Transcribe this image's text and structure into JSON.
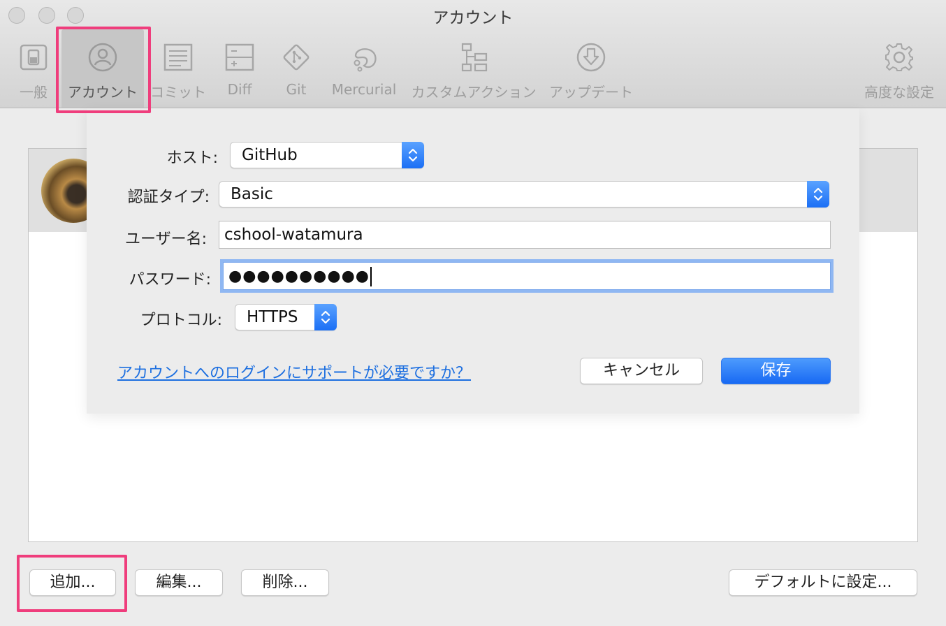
{
  "window": {
    "title": "アカウント"
  },
  "toolbar": {
    "items": [
      {
        "label": "一般",
        "icon": "switch-icon"
      },
      {
        "label": "アカウント",
        "icon": "user-circle-icon",
        "selected": true
      },
      {
        "label": "コミット",
        "icon": "text-lines-icon"
      },
      {
        "label": "Diff",
        "icon": "diff-icon"
      },
      {
        "label": "Git",
        "icon": "git-icon"
      },
      {
        "label": "Mercurial",
        "icon": "mercurial-icon"
      },
      {
        "label": "カスタムアクション",
        "icon": "flowchart-icon"
      },
      {
        "label": "アップデート",
        "icon": "download-circle-icon"
      },
      {
        "label": "高度な設定",
        "icon": "gear-icon"
      }
    ]
  },
  "form": {
    "host_label": "ホスト:",
    "host_value": "GitHub",
    "auth_label": "認証タイプ:",
    "auth_value": "Basic",
    "user_label": "ユーザー名:",
    "user_value": "cshool-watamura",
    "password_label": "パスワード:",
    "password_value": "●●●●●●●●●●",
    "protocol_label": "プロトコル:",
    "protocol_value": "HTTPS",
    "help_link": "アカウントへのログインにサポートが必要ですか？",
    "cancel": "キャンセル",
    "save": "保存"
  },
  "bottom": {
    "add": "追加...",
    "edit": "編集...",
    "delete": "削除...",
    "set_default": "デフォルトに設定..."
  },
  "colors": {
    "accent": "#1a6ff4",
    "highlight": "#ef3d7c",
    "link": "#1d6fe0"
  }
}
